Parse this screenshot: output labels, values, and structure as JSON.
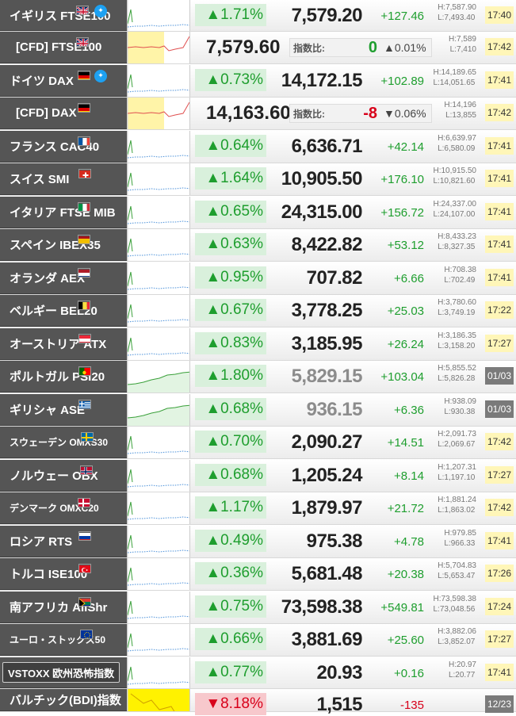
{
  "rows": [
    {
      "name": "イギリス FTSE100",
      "flag": "uk",
      "twitter": true,
      "change": "▲1.71%",
      "price": "7,579.20",
      "diff": "+127.46",
      "high": "H:7,587.90",
      "low": "L:7,493.40",
      "time": "17:40"
    },
    {
      "cfd": true,
      "name": "[CFD] FTSE100",
      "flag": "uk",
      "price": "7,579.60",
      "ratio_label": "指数比:",
      "ratio_num": "0",
      "ratio_pct": "▲0.01%",
      "high": "H:7,589",
      "low": "L:7,410",
      "time": "17:42"
    },
    {
      "name": "ドイツ DAX",
      "flag": "de",
      "twitter": true,
      "change": "▲0.73%",
      "price": "14,172.15",
      "diff": "+102.89",
      "high": "H:14,189.65",
      "low": "L:14,051.65",
      "time": "17:41"
    },
    {
      "cfd": true,
      "name": "[CFD] DAX",
      "flag": "de",
      "price": "14,163.60",
      "ratio_label": "指数比:",
      "ratio_num": "-8",
      "ratio_pct": "▼0.06%",
      "high": "H:14,196",
      "low": "L:13,855",
      "time": "17:42"
    },
    {
      "name": "フランス CAC40",
      "flag": "fr",
      "change": "▲0.64%",
      "price": "6,636.71",
      "diff": "+42.14",
      "high": "H:6,639.97",
      "low": "L:6,580.09",
      "time": "17:41"
    },
    {
      "name": "スイス SMI",
      "flag": "ch",
      "change": "▲1.64%",
      "price": "10,905.50",
      "diff": "+176.10",
      "high": "H:10,915.50",
      "low": "L:10,821.60",
      "time": "17:41"
    },
    {
      "name": "イタリア FTSE MIB",
      "flag": "it",
      "change": "▲0.65%",
      "price": "24,315.00",
      "diff": "+156.72",
      "high": "H:24,337.00",
      "low": "L:24,107.00",
      "time": "17:41"
    },
    {
      "name": "スペイン IBEX35",
      "flag": "es",
      "change": "▲0.63%",
      "price": "8,422.82",
      "diff": "+53.12",
      "high": "H:8,433.23",
      "low": "L:8,327.35",
      "time": "17:41"
    },
    {
      "name": "オランダ AEX",
      "flag": "nl",
      "change": "▲0.95%",
      "price": "707.82",
      "diff": "+6.66",
      "high": "H:708.38",
      "low": "L:702.49",
      "time": "17:41"
    },
    {
      "name": "ベルギー BEL20",
      "flag": "be",
      "change": "▲0.67%",
      "price": "3,778.25",
      "diff": "+25.03",
      "high": "H:3,780.60",
      "low": "L:3,749.19",
      "time": "17:22"
    },
    {
      "name": "オーストリア ATX",
      "flag": "at",
      "change": "▲0.83%",
      "price": "3,185.95",
      "diff": "+26.24",
      "high": "H:3,186.35",
      "low": "L:3,158.20",
      "time": "17:27"
    },
    {
      "name": "ポルトガル PSI20",
      "flag": "pt",
      "change": "▲1.80%",
      "price": "5,829.15",
      "priceGrey": true,
      "diff": "+103.04",
      "high": "H:5,855.52",
      "low": "L:5,826.28",
      "time": "01/03",
      "closed": true
    },
    {
      "name": "ギリシャ ASE",
      "flag": "gr",
      "change": "▲0.68%",
      "price": "936.15",
      "priceGrey": true,
      "diff": "+6.36",
      "high": "H:938.09",
      "low": "L:930.38",
      "time": "01/03",
      "closed": true
    },
    {
      "name": "スウェーデン OMXS30",
      "flag": "se",
      "small": true,
      "change": "▲0.70%",
      "price": "2,090.27",
      "diff": "+14.51",
      "high": "H:2,091.73",
      "low": "L:2,069.67",
      "time": "17:42"
    },
    {
      "name": "ノルウェー OBX",
      "flag": "no",
      "change": "▲0.68%",
      "price": "1,205.24",
      "diff": "+8.14",
      "high": "H:1,207.31",
      "low": "L:1,197.10",
      "time": "17:27"
    },
    {
      "name": "デンマーク OMXC20",
      "flag": "dk",
      "small": true,
      "change": "▲1.17%",
      "price": "1,879.97",
      "diff": "+21.72",
      "high": "H:1,881.24",
      "low": "L:1,863.02",
      "time": "17:42"
    },
    {
      "name": "ロシア RTS",
      "flag": "ru",
      "change": "▲0.49%",
      "price": "975.38",
      "diff": "+4.78",
      "high": "H:979.85",
      "low": "L:966.33",
      "time": "17:41"
    },
    {
      "name": "トルコ ISE100",
      "flag": "tr",
      "change": "▲0.36%",
      "price": "5,681.48",
      "diff": "+20.38",
      "high": "H:5,704.83",
      "low": "L:5,653.47",
      "time": "17:26"
    },
    {
      "name": "南アフリカ AllShr",
      "flag": "za",
      "change": "▲0.75%",
      "price": "73,598.38",
      "diff": "+549.81",
      "high": "H:73,598.38",
      "low": "L:73,048.56",
      "time": "17:24"
    },
    {
      "name": "ユーロ・ストックス50",
      "flag": "eu",
      "small": true,
      "change": "▲0.66%",
      "price": "3,881.69",
      "diff": "+25.60",
      "high": "H:3,882.06",
      "low": "L:3,852.07",
      "time": "17:27"
    },
    {
      "name": "VSTOXX 欧州恐怖指数",
      "button": true,
      "change": "▲0.77%",
      "price": "20.93",
      "diff": "+0.16",
      "high": "H:20.97",
      "low": "L:20.77",
      "time": "17:41"
    },
    {
      "name": "バルチック(BDI)指数",
      "change": "▼8.18%",
      "down": true,
      "price": "1,515",
      "diff": "-135",
      "high": "",
      "low": "",
      "time": "12/23",
      "closed": true
    }
  ]
}
